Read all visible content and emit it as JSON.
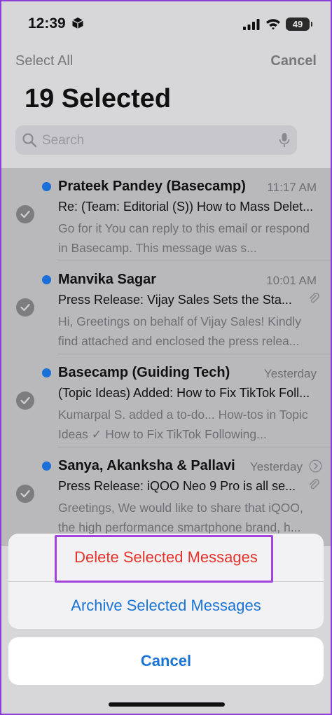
{
  "status_bar": {
    "time": "12:39",
    "battery": "49"
  },
  "header": {
    "select_all": "Select All",
    "cancel": "Cancel",
    "title": "19 Selected"
  },
  "search": {
    "placeholder": "Search",
    "value": ""
  },
  "messages": [
    {
      "sender": "Prateek Pandey (Basecamp)",
      "time": "11:17 AM",
      "subject": "Re: (Team: Editorial (S)) How to Mass Delet...",
      "preview": "Go for it You can reply to this email or respond in Basecamp. This message was s...",
      "unread": true,
      "selected": true,
      "attachment": false,
      "thread": false
    },
    {
      "sender": "Manvika Sagar",
      "time": "10:01 AM",
      "subject": "Press Release: Vijay Sales Sets the Sta...",
      "preview": "Hi, Greetings on behalf of Vijay Sales! Kindly find attached and enclosed the press relea...",
      "unread": true,
      "selected": true,
      "attachment": true,
      "thread": false
    },
    {
      "sender": "Basecamp (Guiding Tech)",
      "time": "Yesterday",
      "subject": "(Topic Ideas) Added: How to Fix TikTok Foll...",
      "preview": "Kumarpal S. added a to-do... How-tos in Topic Ideas ✓ How to Fix TikTok Following...",
      "unread": true,
      "selected": true,
      "attachment": false,
      "thread": false
    },
    {
      "sender": "Sanya, Akanksha & Pallavi",
      "time": "Yesterday",
      "subject": "Press Release: iQOO Neo 9 Pro is all se...",
      "preview": "Greetings, We would like to share that iQOO, the high performance smartphone brand, h...",
      "unread": true,
      "selected": true,
      "attachment": true,
      "thread": true
    }
  ],
  "action_sheet": {
    "delete_label": "Delete Selected Messages",
    "archive_label": "Archive Selected Messages",
    "cancel_label": "Cancel"
  },
  "colors": {
    "accent": "#1a74d6",
    "destructive": "#e5342c",
    "unread_dot": "#1a6fd9",
    "highlight": "#a244db"
  }
}
